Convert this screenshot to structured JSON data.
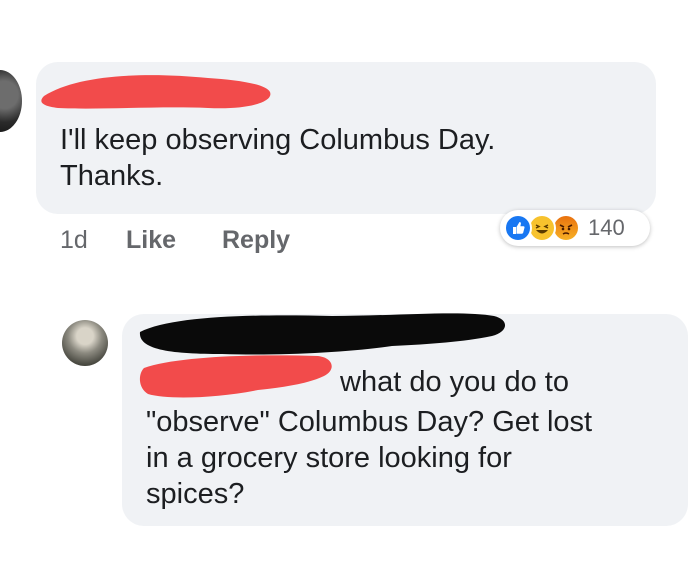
{
  "comment_1": {
    "text": "I'll keep observing Columbus Day.\nThanks.",
    "time": "1d",
    "like_label": "Like",
    "reply_label": "Reply",
    "reaction_count": "140",
    "reactions": [
      "like-icon",
      "haha-icon",
      "angry-icon"
    ]
  },
  "comment_2": {
    "text_first_line": "what do you do to",
    "text_rest": "\"observe\" Columbus Day? Get lost\nin a grocery store looking for\nspices?"
  },
  "colors": {
    "bubble": "#f0f2f5",
    "text": "#1c1e21",
    "meta": "#65676b",
    "redaction_red": "#f24b4b",
    "redaction_black": "#0a0a0a",
    "like_blue": "#1877f2"
  }
}
